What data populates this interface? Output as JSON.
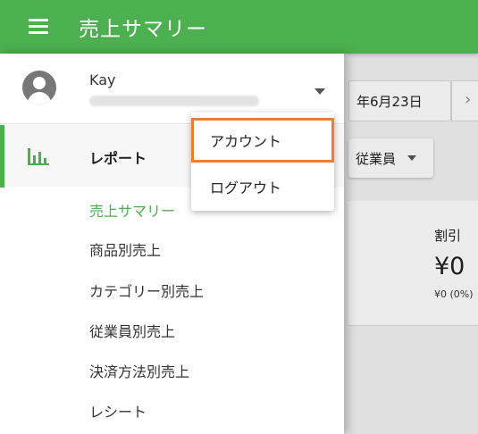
{
  "appbar": {
    "title": "売上サマリー",
    "menu_icon": "hamburger-menu-icon",
    "color": "#4caf50"
  },
  "background": {
    "date": "年6月23日",
    "next_glyph": "›",
    "employee_filter": "従業員",
    "card_label": "割引",
    "card_value": "¥0",
    "card_sub": "¥0 (0%)"
  },
  "drawer": {
    "user_name": "Kay",
    "avatar_icon": "account-circle-icon",
    "report_label": "レポート",
    "report_icon": "bar-chart-icon",
    "accent": "#4caf50",
    "submenu": [
      {
        "label": "売上サマリー",
        "active": true
      },
      {
        "label": "商品別売上",
        "active": false
      },
      {
        "label": "カテゴリー別売上",
        "active": false
      },
      {
        "label": "従業員別売上",
        "active": false
      },
      {
        "label": "決済方法別売上",
        "active": false
      },
      {
        "label": "レシート",
        "active": false
      }
    ]
  },
  "popup": {
    "items": [
      "アカウント",
      "ログアウト"
    ],
    "highlight_color": "#ed7d31"
  }
}
